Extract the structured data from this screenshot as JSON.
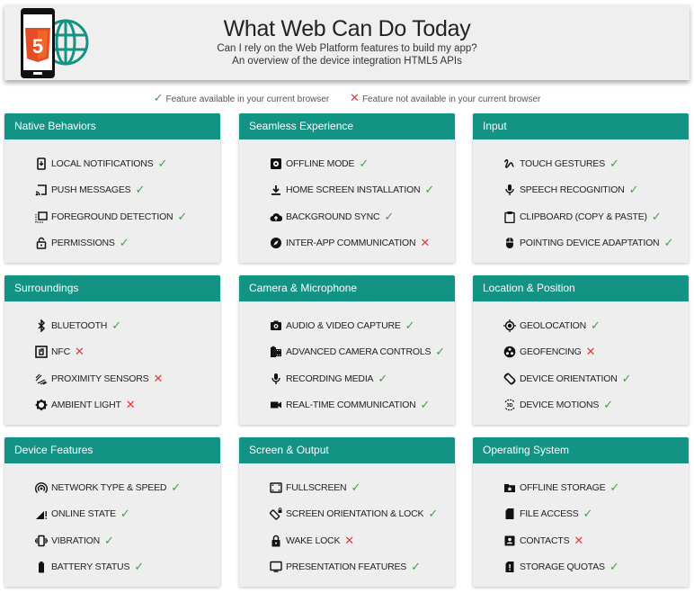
{
  "header": {
    "title": "What Web Can Do Today",
    "subtitle_line1": "Can I rely on the Web Platform features to build my app?",
    "subtitle_line2": "An overview of the device integration HTML5 APIs",
    "logo_icon": "html5-phone-globe-logo"
  },
  "legend": {
    "available_symbol": "✓",
    "available_label": "Feature available in your current browser",
    "unavailable_symbol": "✕",
    "unavailable_label": "Feature not available in your current browser"
  },
  "colors": {
    "accent": "#139384",
    "available": "#43a047",
    "unavailable": "#e53935",
    "html5_orange": "#e44d26"
  },
  "categories": [
    {
      "title": "Native Behaviors",
      "features": [
        {
          "label": "LOCAL NOTIFICATIONS",
          "icon": "phone-notification-icon",
          "available": true,
          "status": "✓"
        },
        {
          "label": "PUSH MESSAGES",
          "icon": "cast-icon",
          "available": true,
          "status": "✓"
        },
        {
          "label": "FOREGROUND DETECTION",
          "icon": "selection-icon",
          "available": true,
          "status": "✓"
        },
        {
          "label": "PERMISSIONS",
          "icon": "lock-open-icon",
          "available": true,
          "status": "✓"
        }
      ]
    },
    {
      "title": "Seamless Experience",
      "features": [
        {
          "label": "OFFLINE MODE",
          "icon": "settings-box-icon",
          "available": true,
          "status": "✓"
        },
        {
          "label": "HOME SCREEN INSTALLATION",
          "icon": "download-icon",
          "available": true,
          "status": "✓"
        },
        {
          "label": "BACKGROUND SYNC",
          "icon": "cloud-upload-icon",
          "available": true,
          "status": "✓"
        },
        {
          "label": "INTER-APP COMMUNICATION",
          "icon": "compass-icon",
          "available": false,
          "status": "✕"
        }
      ]
    },
    {
      "title": "Input",
      "features": [
        {
          "label": "TOUCH GESTURES",
          "icon": "gesture-icon",
          "available": true,
          "status": "✓"
        },
        {
          "label": "SPEECH RECOGNITION",
          "icon": "microphone-icon",
          "available": true,
          "status": "✓"
        },
        {
          "label": "CLIPBOARD (COPY & PASTE)",
          "icon": "clipboard-icon",
          "available": true,
          "status": "✓"
        },
        {
          "label": "POINTING DEVICE ADAPTATION",
          "icon": "mouse-icon",
          "available": true,
          "status": "✓"
        }
      ]
    },
    {
      "title": "Surroundings",
      "features": [
        {
          "label": "BLUETOOTH",
          "icon": "bluetooth-icon",
          "available": true,
          "status": "✓"
        },
        {
          "label": "NFC",
          "icon": "nfc-icon",
          "available": false,
          "status": "✕"
        },
        {
          "label": "PROXIMITY SENSORS",
          "icon": "proximity-icon",
          "available": false,
          "status": "✕"
        },
        {
          "label": "AMBIENT LIGHT",
          "icon": "brightness-icon",
          "available": false,
          "status": "✕"
        }
      ]
    },
    {
      "title": "Camera & Microphone",
      "features": [
        {
          "label": "AUDIO & VIDEO CAPTURE",
          "icon": "camera-icon",
          "available": true,
          "status": "✓"
        },
        {
          "label": "ADVANCED CAMERA CONTROLS",
          "icon": "camera-roll-icon",
          "available": true,
          "status": "✓"
        },
        {
          "label": "RECORDING MEDIA",
          "icon": "microphone-icon",
          "available": true,
          "status": "✓"
        },
        {
          "label": "REAL-TIME COMMUNICATION",
          "icon": "videocam-icon",
          "available": true,
          "status": "✓"
        }
      ]
    },
    {
      "title": "Location & Position",
      "features": [
        {
          "label": "GEOLOCATION",
          "icon": "gps-target-icon",
          "available": true,
          "status": "✓"
        },
        {
          "label": "GEOFENCING",
          "icon": "geofence-icon",
          "available": false,
          "status": "✕"
        },
        {
          "label": "DEVICE ORIENTATION",
          "icon": "screen-rotation-icon",
          "available": true,
          "status": "✓"
        },
        {
          "label": "DEVICE MOTIONS",
          "icon": "3d-rotation-icon",
          "available": true,
          "status": "✓"
        }
      ]
    },
    {
      "title": "Device Features",
      "features": [
        {
          "label": "NETWORK TYPE & SPEED",
          "icon": "wifi-tethering-icon",
          "available": true,
          "status": "✓"
        },
        {
          "label": "ONLINE STATE",
          "icon": "signal-icon",
          "available": true,
          "status": "✓"
        },
        {
          "label": "VIBRATION",
          "icon": "vibration-icon",
          "available": true,
          "status": "✓"
        },
        {
          "label": "BATTERY STATUS",
          "icon": "battery-icon",
          "available": true,
          "status": "✓"
        }
      ]
    },
    {
      "title": "Screen & Output",
      "features": [
        {
          "label": "FULLSCREEN",
          "icon": "fullscreen-icon",
          "available": true,
          "status": "✓"
        },
        {
          "label": "SCREEN ORIENTATION & LOCK",
          "icon": "screen-lock-rotation-icon",
          "available": true,
          "status": "✓"
        },
        {
          "label": "WAKE LOCK",
          "icon": "lock-icon",
          "available": false,
          "status": "✕"
        },
        {
          "label": "PRESENTATION FEATURES",
          "icon": "monitor-icon",
          "available": true,
          "status": "✓"
        }
      ]
    },
    {
      "title": "Operating System",
      "features": [
        {
          "label": "OFFLINE STORAGE",
          "icon": "folder-star-icon",
          "available": true,
          "status": "✓"
        },
        {
          "label": "FILE ACCESS",
          "icon": "sd-card-icon",
          "available": true,
          "status": "✓"
        },
        {
          "label": "CONTACTS",
          "icon": "contact-card-icon",
          "available": false,
          "status": "✕"
        },
        {
          "label": "STORAGE QUOTAS",
          "icon": "sd-card-alert-icon",
          "available": true,
          "status": "✓"
        }
      ]
    }
  ]
}
